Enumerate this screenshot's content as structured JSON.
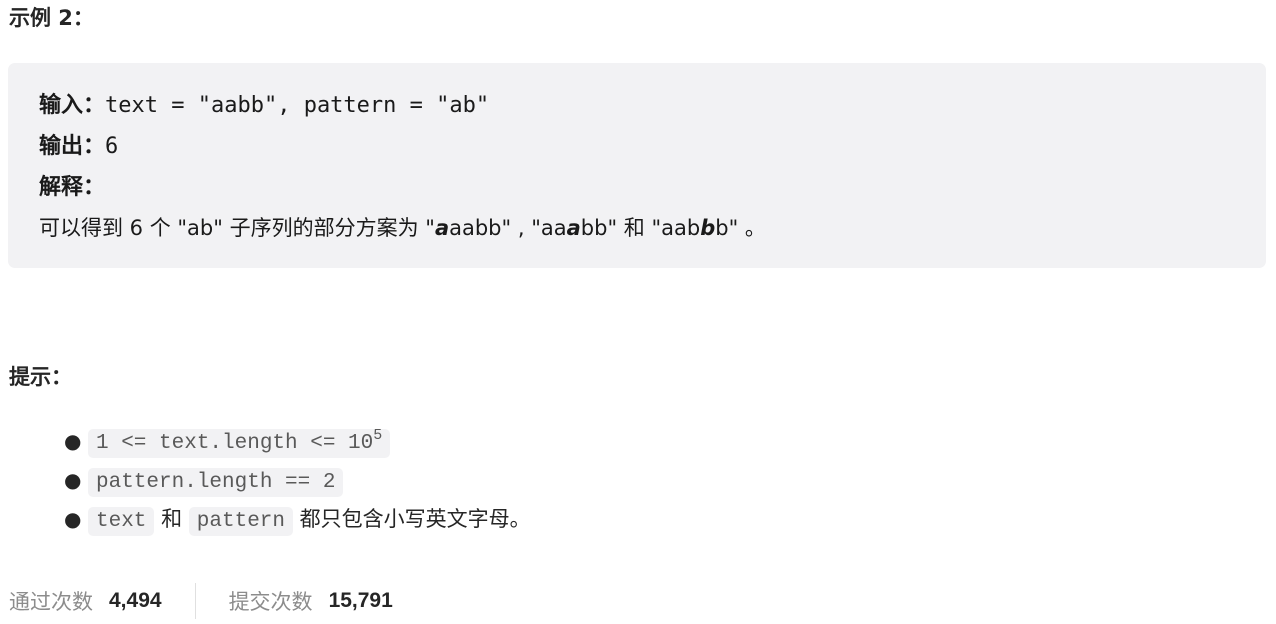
{
  "example": {
    "title": "示例 2：",
    "input_label": "输入：",
    "input_value": "text = \"aabb\", pattern = \"ab\"",
    "output_label": "输出：",
    "output_value": "6",
    "explanation_label": "解释：",
    "explanation": {
      "prefix": "可以得到 6 个 \"ab\" 子序列的部分方案为 ",
      "option1_open": "\"",
      "option1_bold": "a",
      "option1_rest": "aabb\"",
      "sep1": " , ",
      "option2_pre": "\"aa",
      "option2_bold": "a",
      "option2_rest": "bb\"",
      "sep2": " 和 ",
      "option3_pre": "\"aab",
      "option3_bold": "b",
      "option3_rest": "b\"",
      "suffix": " 。"
    }
  },
  "hints": {
    "title": "提示：",
    "items": [
      {
        "code": "1 <= text.length <= 10",
        "sup": "5"
      },
      {
        "code": "pattern.length == 2"
      },
      {
        "code_a": "text",
        "mid": " 和 ",
        "code_b": "pattern",
        "tail": " 都只包含小写英文字母。"
      }
    ]
  },
  "stats": {
    "accepted_label": "通过次数",
    "accepted_value": "4,494",
    "submissions_label": "提交次数",
    "submissions_value": "15,791"
  }
}
